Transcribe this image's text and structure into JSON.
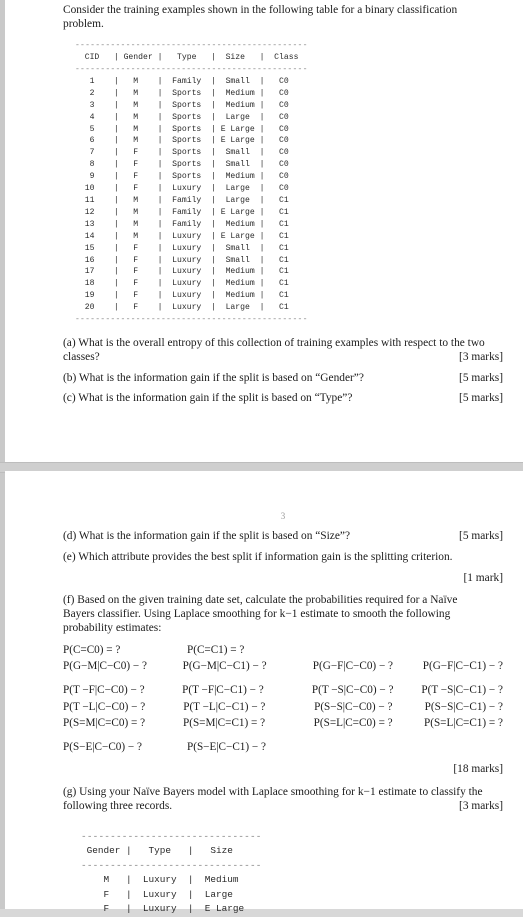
{
  "document": {
    "page_number": "3"
  },
  "page1": {
    "intro": "Consider the training examples shown in the following table for a binary classification problem.",
    "table": {
      "top_rule": "----------------------------------------------",
      "header": "  CID   | Gender |   Type   |  Size   |  Class",
      "mid_rule": "----------------------------------------------",
      "rows": [
        "   1    |   M    |  Family  |  Small  |   C0",
        "   2    |   M    |  Sports  |  Medium |   C0",
        "   3    |   M    |  Sports  |  Medium |   C0",
        "   4    |   M    |  Sports  |  Large  |   C0",
        "   5    |   M    |  Sports  | E Large |   C0",
        "   6    |   M    |  Sports  | E Large |   C0",
        "   7    |   F    |  Sports  |  Small  |   C0",
        "   8    |   F    |  Sports  |  Small  |   C0",
        "   9    |   F    |  Sports  |  Medium |   C0",
        "  10    |   F    |  Luxury  |  Large  |   C0",
        "  11    |   M    |  Family  |  Large  |   C1",
        "  12    |   M    |  Family  | E Large |   C1",
        "  13    |   M    |  Family  |  Medium |   C1",
        "  14    |   M    |  Luxury  | E Large |   C1",
        "  15    |   F    |  Luxury  |  Small  |   C1",
        "  16    |   F    |  Luxury  |  Small  |   C1",
        "  17    |   F    |  Luxury  |  Medium |   C1",
        "  18    |   F    |  Luxury  |  Medium |   C1",
        "  19    |   F    |  Luxury  |  Medium |   C1",
        "  20    |   F    |  Luxury  |  Large  |   C1"
      ],
      "bottom_rule": "----------------------------------------------"
    },
    "questions": [
      {
        "text": " (a) What is the overall entropy of this collection of training examples with respect to the two classes?",
        "marks": "[3 marks]"
      },
      {
        "text": "(b) What is the information gain if the split is based on “Gender”?",
        "marks": "[5 marks]"
      },
      {
        "text": "(c) What is the information gain if the split is based on “Type”?",
        "marks": "[5 marks]"
      }
    ]
  },
  "page2": {
    "questions": [
      {
        "text": "(d) What is the information gain if the split is based on “Size”?",
        "marks": "[5 marks]"
      },
      {
        "text": "(e) Which attribute provides the best split if information gain is the splitting criterion.",
        "marks": "[1 mark]"
      }
    ],
    "part_f": {
      "text": "(f) Based on the given training date set, calculate the probabilities required for a Naïve Bayers classifier. Using Laplace smoothing for k−1 estimate to smooth the following probability estimates:",
      "marks": "[18 marks]"
    },
    "probabilities": {
      "group1": [
        [
          "P(C=C0) = ?",
          "P(C=C1) = ?",
          "",
          ""
        ],
        [
          "P(G−M|C−C0) − ?",
          "P(G−M|C−C1) − ?",
          "P(G−F|C−C0) − ?",
          "P(G−F|C−C1) − ?"
        ]
      ],
      "group2": [
        [
          "P(T −F|C−C0) − ?",
          "P(T −F|C−C1) − ?",
          "P(T −S|C−C0) − ?",
          "P(T −S|C−C1) − ?"
        ],
        [
          "P(T −L|C−C0) − ?",
          "P(T −L|C−C1) − ?",
          "P(S−S|C−C0) − ?",
          "P(S−S|C−C1) − ?"
        ],
        [
          "P(S=M|C=C0) = ?",
          "P(S=M|C=C1) = ?",
          "P(S=L|C=C0) = ?",
          "P(S=L|C=C1) = ?"
        ]
      ],
      "group3": [
        [
          "P(S−E|C−C0) − ?",
          "P(S−E|C−C1) − ?",
          "",
          ""
        ]
      ]
    },
    "part_g": {
      "text": "(g) Using your Naïve Bayers model with Laplace smoothing for k−1 estimate to classify the following three records.",
      "marks": "[3 marks]"
    },
    "table": {
      "top_rule": "-------------------------------",
      "header": " Gender |   Type   |   Size",
      "mid_rule": "-------------------------------",
      "rows": [
        "    M   |  Luxury  |  Medium",
        "    F   |  Luxury  |  Large",
        "    F   |  Luxury  |  E Large"
      ]
    }
  }
}
